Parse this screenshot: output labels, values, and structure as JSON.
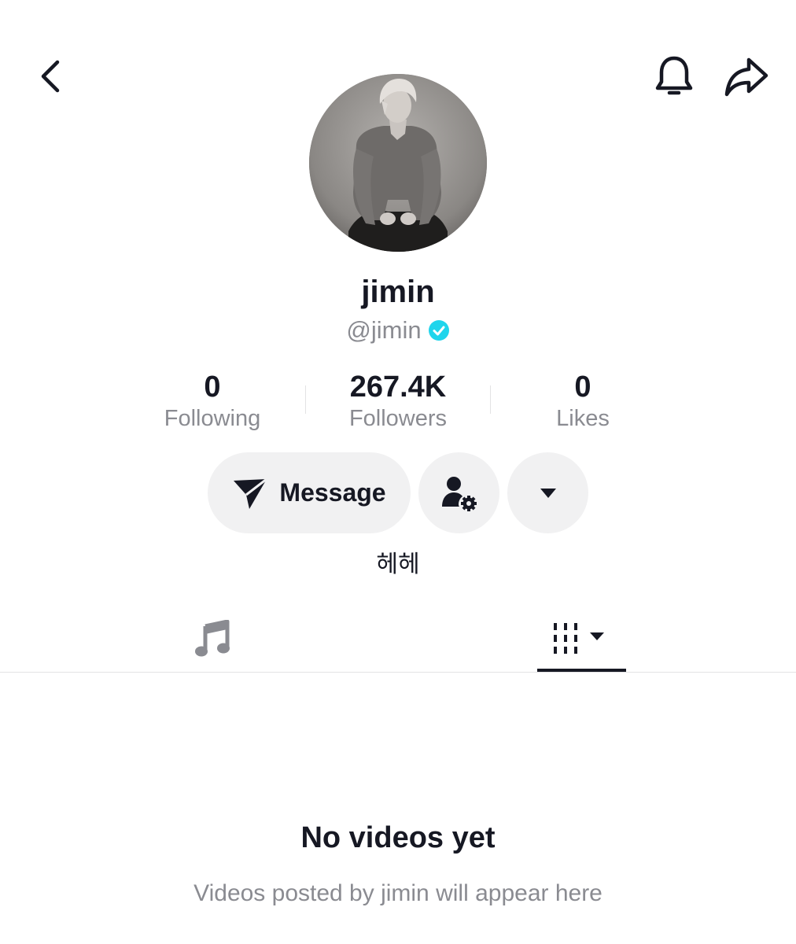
{
  "header": {
    "back_icon": "chevron-left-icon",
    "notify_icon": "bell-icon",
    "share_icon": "share-arrow-icon"
  },
  "profile": {
    "avatar_alt": "profile photo",
    "display_name": "jimin",
    "handle": "@jimin",
    "verified": true,
    "verified_color": "#20d5ec",
    "bio": "헤헤"
  },
  "stats": {
    "following": {
      "value": "0",
      "label": "Following"
    },
    "followers": {
      "value": "267.4K",
      "label": "Followers"
    },
    "likes": {
      "value": "0",
      "label": "Likes"
    }
  },
  "actions": {
    "message_label": "Message",
    "message_icon": "send-icon",
    "manage_icon": "user-settings-icon",
    "more_icon": "caret-down-icon"
  },
  "tabs": [
    {
      "name": "music",
      "icon": "music-note-icon",
      "active": false
    },
    {
      "name": "videos",
      "icon": "grid-filter-icon",
      "active": true
    }
  ],
  "empty_state": {
    "title": "No videos yet",
    "subtitle": "Videos posted by jimin will appear here"
  },
  "colors": {
    "text_primary": "#161823",
    "text_secondary": "#8a8b91",
    "button_bg": "#f1f1f2",
    "divider": "#e3e3e4"
  }
}
